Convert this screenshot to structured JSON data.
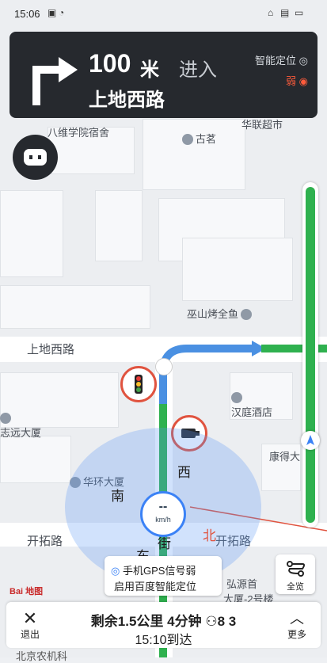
{
  "status_bar": {
    "time": "15:06"
  },
  "nav": {
    "distance": "100",
    "unit": "米",
    "action": "进入",
    "street": "上地西路",
    "smart_location": "智能定位",
    "signal": "弱"
  },
  "map_labels": {
    "top_left": "八维学院宿舍",
    "top_right": "华联超市",
    "guming": "古茗",
    "bbq": "巫山烤全鱼",
    "road_left": "上地西路",
    "hanting": "汉庭酒店",
    "zhiyuan": "志远大厦",
    "kangde": "康得大",
    "huahuan": "华环大厦",
    "kaituo_left": "开拓路",
    "kaituo_right": "开拓路",
    "hongyuan": "弘源首",
    "dasha": "大厦-2号楼",
    "bottom_edge": "北京农机科"
  },
  "compass": {
    "south": "南",
    "west": "西",
    "north": "北",
    "east": "东",
    "street_char": "街"
  },
  "speed": {
    "value": "--",
    "unit": "km/h"
  },
  "gps": {
    "line1": "手机GPS信号弱",
    "line2": "启用百度智能定位"
  },
  "overview": {
    "label": "全览"
  },
  "logo": "Bai 地图",
  "bottom": {
    "exit_label": "退出",
    "remaining": "剩余1.5公里 4分钟",
    "lights": "8 3",
    "arrive": "15:10到达",
    "more_label": "更多"
  },
  "colors": {
    "route_green": "#2fb14f",
    "route_blue": "#4a90e2",
    "card_dark": "#26292e"
  }
}
